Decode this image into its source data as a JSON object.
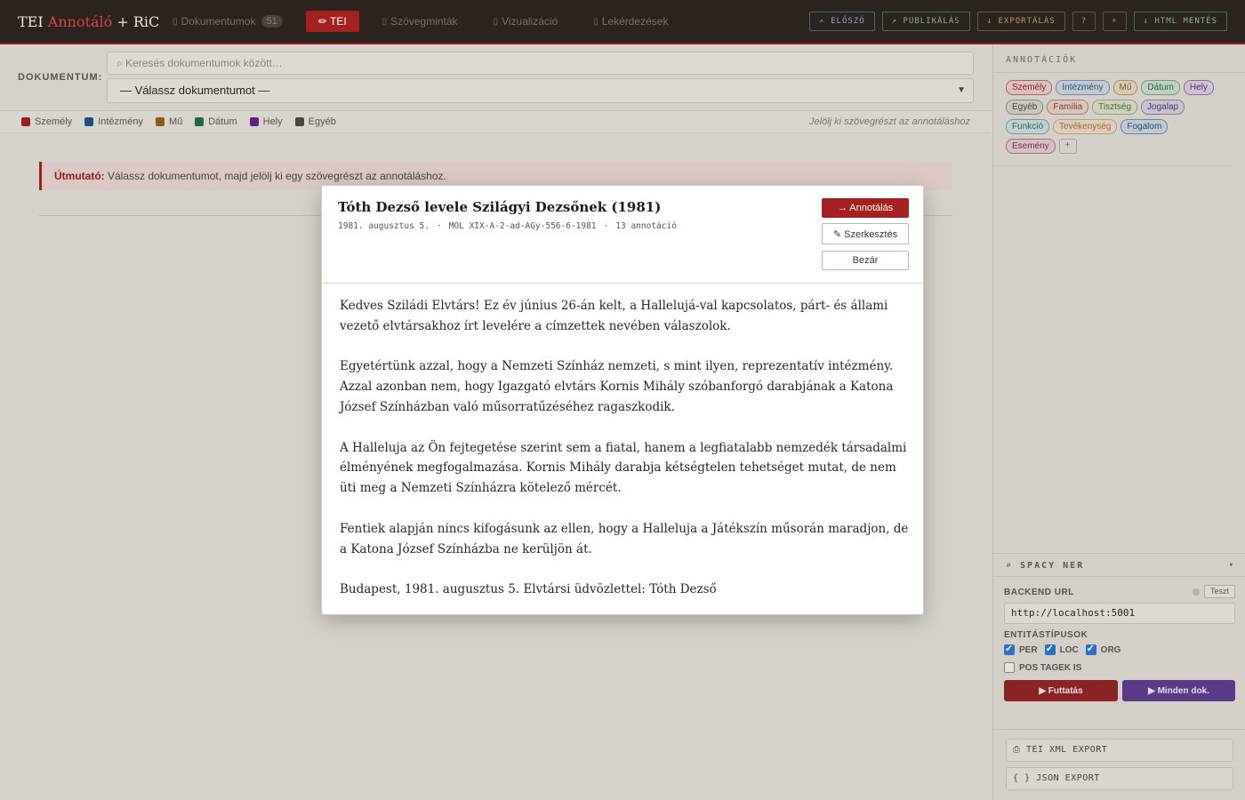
{
  "app": {
    "brand_a": "TEI",
    "brand_b": "Annotáló",
    "brand_c": "+ RiC"
  },
  "nav": {
    "documents": "Dokumentumok",
    "documents_count": "51",
    "tei": "✏ TEI",
    "text_samples": "Szövegminták",
    "visualization": "Vizualizáció",
    "queries": "Lekérdezések"
  },
  "top_actions": {
    "preface": "✍ ELŐSZÓ",
    "publish": "↗ PUBLIKÁLÁS",
    "export": "↓ EXPORTÁLÁS",
    "help": "?",
    "theme": "☀",
    "html_save": "↓ HTML MENTÉS"
  },
  "doc_selector": {
    "label": "DOKUMENTUM:",
    "search_placeholder": "⌕ Keresés dokumentumok között…",
    "select_value": "— Válassz dokumentumot —"
  },
  "legend": {
    "items": [
      {
        "label": "Személy",
        "color": "#9b1c1c"
      },
      {
        "label": "Intézmény",
        "color": "#1f4e82"
      },
      {
        "label": "Mű",
        "color": "#8a5a18"
      },
      {
        "label": "Dátum",
        "color": "#1e6b42"
      },
      {
        "label": "Hely",
        "color": "#5e2287"
      },
      {
        "label": "Egyéb",
        "color": "#4a4642"
      }
    ],
    "hint": "Jelölj ki szövegrészt az annotáláshoz"
  },
  "guide": {
    "label": "Útmutató:",
    "text": " Válassz dokumentumot, majd jelölj ki egy szövegrészt az annotáláshoz."
  },
  "right_panel": {
    "title": "ANNOTÁCIÓK",
    "chips": [
      {
        "label": "Személy",
        "cls": "c-szemely"
      },
      {
        "label": "Intézmény",
        "cls": "c-intezmeny"
      },
      {
        "label": "Mű",
        "cls": "c-mu"
      },
      {
        "label": "Dátum",
        "cls": "c-datum"
      },
      {
        "label": "Hely",
        "cls": "c-hely"
      },
      {
        "label": "Egyéb",
        "cls": "c-egyeb"
      },
      {
        "label": "Família",
        "cls": "c-familia"
      },
      {
        "label": "Tisztség",
        "cls": "c-tisztseg"
      },
      {
        "label": "Jogalap",
        "cls": "c-jogalap"
      },
      {
        "label": "Funkció",
        "cls": "c-funkcio"
      },
      {
        "label": "Tevékenység",
        "cls": "c-tevekenyseg"
      },
      {
        "label": "Fogalom",
        "cls": "c-fogalom"
      },
      {
        "label": "Esemény",
        "cls": "c-esemeny"
      },
      {
        "label": "+",
        "cls": "c-plus"
      }
    ]
  },
  "spacy": {
    "title": "⌕ SPACY NER",
    "toggle": "▾",
    "backend_label": "BACKEND URL",
    "test_button": "Teszt",
    "backend_url": "http://localhost:5001",
    "entity_label": "ENTITÁSTÍPUSOK",
    "per": "PER",
    "loc": "LOC",
    "org": "ORG",
    "pos_tags": "POS TAGEK IS",
    "run": "▶ Futtatás",
    "run_all": "▶ Minden dok."
  },
  "exports": {
    "tei_xml": "⎙ TEI XML EXPORT",
    "json": "{ } JSON EXPORT"
  },
  "modal": {
    "title": "Tóth Dezső levele Szilágyi Dezsőnek (1981)",
    "date": "1981. augusztus 5.",
    "signature": "MOL XIX-A-2-ad-AGy-556-6-1981",
    "annotations": "13 annotáció",
    "annotate_button": "→ Annotálás",
    "edit_button": "✎ Szerkesztés",
    "close_button": "Bezár",
    "paragraphs": [
      "Kedves Sziládi Elvtárs! Ez év június 26-án kelt, a Hallelujá-val kapcsolatos, párt- és állami vezető elvtársakhoz írt levelére a címzettek nevében válaszolok.",
      "Egyetértünk azzal, hogy a Nemzeti Színház nemzeti, s mint ilyen, reprezentatív intézmény. Azzal azonban nem, hogy Igazgató elvtárs Kornis Mihály szóbanforgó darabjának a Katona József Színházban való műsorratűzéséhez ragaszkodik.",
      "A Halleluja az Ön fejtegetése szerint sem a fiatal, hanem a legfiatalabb nemzedék társadalmi élményének megfogalmazása. Kornis Mihály darabja kétségtelen tehetséget mutat, de nem üti meg a Nemzeti Színházra kötelező mércét.",
      "Fentiek alapján nincs kifogásunk az ellen, hogy a Halleluja a Játékszín műsorán maradjon, de a Katona József Színházba ne kerüljön át.",
      "Budapest, 1981. augusztus 5. Elvtársi üdvözlettel: Tóth Dezső"
    ]
  }
}
